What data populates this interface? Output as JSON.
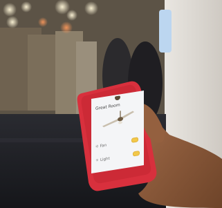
{
  "photo": {
    "subject": "hand holding red smartphone showing fan control app"
  },
  "app": {
    "title": "Great Room",
    "fan_label": "Fan",
    "light_label": "Light",
    "fan_icon": "ceiling-fan-icon",
    "toggle_color": "#f2c84a"
  },
  "colors": {
    "case": "#d8303d",
    "skin": "#8a5a3c",
    "background": "#1a1b1f"
  }
}
